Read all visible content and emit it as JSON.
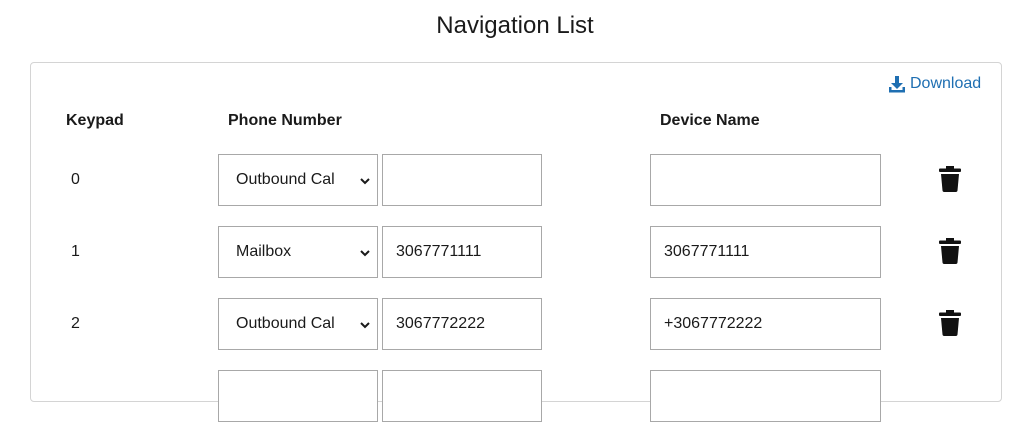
{
  "page": {
    "title": "Navigation List"
  },
  "toolbar": {
    "download_label": "Download",
    "download_icon": "download-icon"
  },
  "table": {
    "headers": {
      "keypad": "Keypad",
      "phone_number": "Phone Number",
      "device_name": "Device Name"
    },
    "rows": [
      {
        "keypad": "0",
        "type": "Outbound Cal",
        "phone": "",
        "device": ""
      },
      {
        "keypad": "1",
        "type": "Mailbox",
        "phone": "3067771111",
        "device": "3067771111"
      },
      {
        "keypad": "2",
        "type": "Outbound Cal",
        "phone": "3067772222",
        "device": "+3067772222"
      },
      {
        "keypad": "",
        "type": "",
        "phone": "",
        "device": ""
      }
    ]
  },
  "colors": {
    "link": "#1f6fb2",
    "border": "#a8a8a8",
    "text": "#1a1a1a"
  }
}
